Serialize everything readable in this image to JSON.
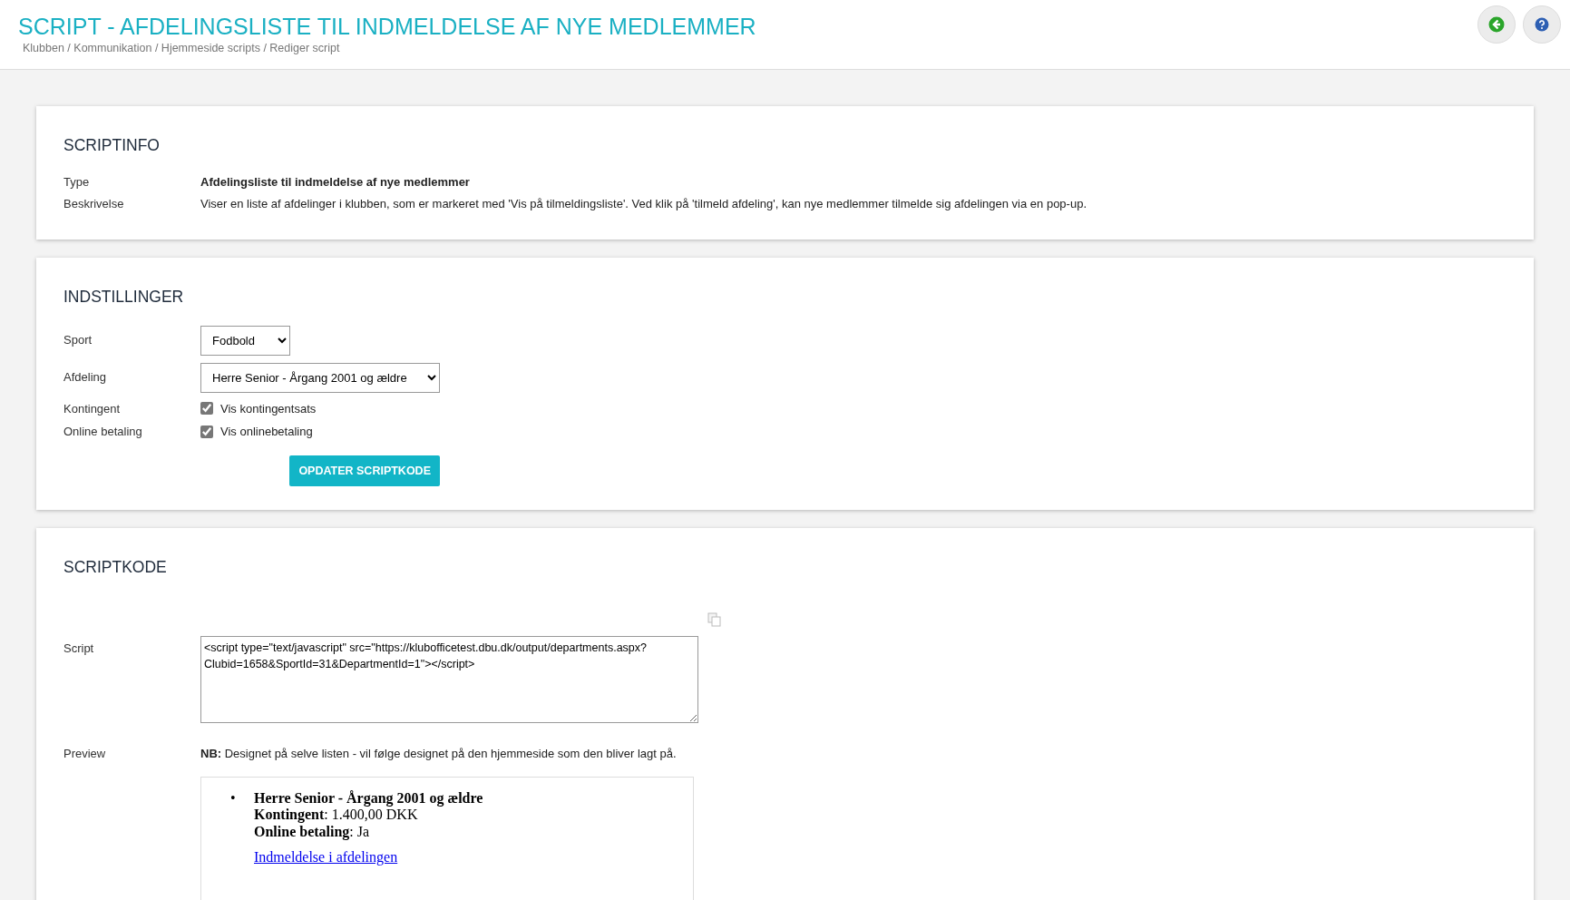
{
  "header": {
    "title": "SCRIPT - AFDELINGSLISTE TIL INDMELDELSE AF NYE MEDLEMMER",
    "breadcrumb": "Klubben / Kommunikation / Hjemmeside scripts / Rediger script"
  },
  "scriptinfo": {
    "heading": "SCRIPTINFO",
    "rows": [
      {
        "label": "Type",
        "value": "Afdelingsliste til indmeldelse af nye medlemmer",
        "kind": "strong"
      },
      {
        "label": "Beskrivelse",
        "value": "Viser en liste af afdelinger i klubben, som er markeret med 'Vis på tilmeldingsliste'. Ved klik på 'tilmeld afdeling', kan nye medlemmer tilmelde sig afdelingen via en pop-up.",
        "kind": "plain"
      }
    ]
  },
  "settings": {
    "heading": "INDSTILLINGER",
    "rows": [
      {
        "label": "Sport",
        "kind": "select",
        "value": "Fodbold"
      },
      {
        "label": "Afdeling",
        "kind": "select",
        "value": "Herre Senior - Årgang 2001 og ældre"
      },
      {
        "label": "Kontingent",
        "kind": "checkbox",
        "text": "Vis kontingentsats",
        "checked": true
      },
      {
        "label": "Online betaling",
        "kind": "checkbox",
        "text": "Vis onlinebetaling",
        "checked": true
      }
    ],
    "button": "OPDATER SCRIPTKODE"
  },
  "scriptcode": {
    "heading": "SCRIPTKODE",
    "script_label": "Script",
    "script": "<script type=\"text/javascript\" src=\"https://klubofficetest.dbu.dk/output/departments.aspx?Clubid=1658&SportId=31&DepartmentId=1\"></script>",
    "preview_label": "Preview",
    "note": "**NB:** Designet på selve listen - vil følge designet på den hjemmeside som den bliver lagt på.",
    "preview": {
      "bullet": "•",
      "title": "Herre Senior - Årgang 2001 og ældre",
      "lines": [
        "**Kontingent**: 1.400,00 DKK",
        "**Online betaling**: Ja"
      ],
      "link": "Indmeldelse i afdelingen"
    }
  }
}
